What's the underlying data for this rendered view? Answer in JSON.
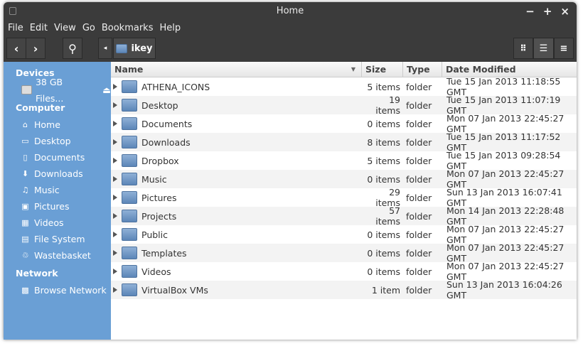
{
  "title": "Home",
  "window_controls": {
    "minimize": "−",
    "maximize": "+",
    "close": "×"
  },
  "menu": [
    "File",
    "Edit",
    "View",
    "Go",
    "Bookmarks",
    "Help"
  ],
  "toolbar": {
    "back": "‹",
    "forward": "›",
    "search": "⚲",
    "path_left": "◂",
    "path": "ikey"
  },
  "sidebar": {
    "devices_label": "Devices",
    "devices": [
      {
        "label": "38 GB Files...",
        "icon": "drive-icon"
      }
    ],
    "computer_label": "Computer",
    "computer": [
      {
        "label": "Home",
        "icon": "⌂"
      },
      {
        "label": "Desktop",
        "icon": "▭"
      },
      {
        "label": "Documents",
        "icon": "▯"
      },
      {
        "label": "Downloads",
        "icon": "⬇"
      },
      {
        "label": "Music",
        "icon": "♫"
      },
      {
        "label": "Pictures",
        "icon": "▣"
      },
      {
        "label": "Videos",
        "icon": "▦"
      },
      {
        "label": "File System",
        "icon": "▤"
      },
      {
        "label": "Wastebasket",
        "icon": "♲"
      }
    ],
    "network_label": "Network",
    "network": [
      {
        "label": "Browse Network",
        "icon": "▩"
      }
    ]
  },
  "columns": [
    "Name",
    "Size",
    "Type",
    "Date Modified"
  ],
  "files": [
    {
      "name": "ATHENA_ICONS",
      "size": "5 items",
      "type": "folder",
      "date": "Tue 15 Jan 2013 11:18:55 GMT"
    },
    {
      "name": "Desktop",
      "size": "19 items",
      "type": "folder",
      "date": "Tue 15 Jan 2013 11:07:19 GMT"
    },
    {
      "name": "Documents",
      "size": "0 items",
      "type": "folder",
      "date": "Mon 07 Jan 2013 22:45:27 GMT"
    },
    {
      "name": "Downloads",
      "size": "8 items",
      "type": "folder",
      "date": "Tue 15 Jan 2013 11:17:52 GMT"
    },
    {
      "name": "Dropbox",
      "size": "5 items",
      "type": "folder",
      "date": "Tue 15 Jan 2013 09:28:54 GMT"
    },
    {
      "name": "Music",
      "size": "0 items",
      "type": "folder",
      "date": "Mon 07 Jan 2013 22:45:27 GMT"
    },
    {
      "name": "Pictures",
      "size": "29 items",
      "type": "folder",
      "date": "Sun 13 Jan 2013 16:07:41 GMT"
    },
    {
      "name": "Projects",
      "size": "57 items",
      "type": "folder",
      "date": "Mon 14 Jan 2013 22:28:48 GMT"
    },
    {
      "name": "Public",
      "size": "0 items",
      "type": "folder",
      "date": "Mon 07 Jan 2013 22:45:27 GMT"
    },
    {
      "name": "Templates",
      "size": "0 items",
      "type": "folder",
      "date": "Mon 07 Jan 2013 22:45:27 GMT"
    },
    {
      "name": "Videos",
      "size": "0 items",
      "type": "folder",
      "date": "Mon 07 Jan 2013 22:45:27 GMT"
    },
    {
      "name": "VirtualBox VMs",
      "size": "1 item",
      "type": "folder",
      "date": "Sun 13 Jan 2013 16:04:26 GMT"
    }
  ]
}
